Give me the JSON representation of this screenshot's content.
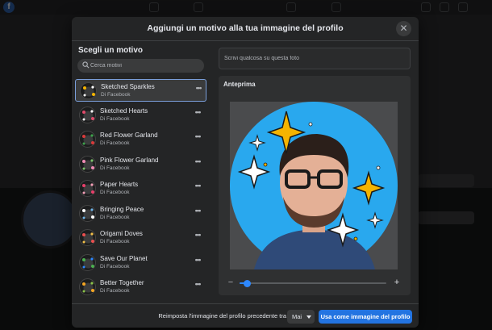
{
  "modal": {
    "title": "Aggiungi un motivo alla tua immagine del profilo",
    "close_icon": "close-icon"
  },
  "left": {
    "heading": "Scegli un motivo",
    "search_placeholder": "Cerca motivi",
    "items": [
      {
        "name": "Sketched Sparkles",
        "by": "Di Facebook",
        "selected": true
      },
      {
        "name": "Sketched Hearts",
        "by": "Di Facebook",
        "selected": false
      },
      {
        "name": "Red Flower Garland",
        "by": "Di Facebook",
        "selected": false
      },
      {
        "name": "Pink Flower Garland",
        "by": "Di Facebook",
        "selected": false
      },
      {
        "name": "Paper Hearts",
        "by": "Di Facebook",
        "selected": false
      },
      {
        "name": "Bringing Peace",
        "by": "Di Facebook",
        "selected": false
      },
      {
        "name": "Origami Doves",
        "by": "Di Facebook",
        "selected": false
      },
      {
        "name": "Save Our Planet",
        "by": "Di Facebook",
        "selected": false
      },
      {
        "name": "Better Together",
        "by": "Di Facebook",
        "selected": false
      }
    ]
  },
  "right": {
    "caption_placeholder": "Scrivi qualcosa su questa foto",
    "preview_heading": "Anteprima",
    "zoom_level": 0.05
  },
  "footer": {
    "revert_label": "Reimposta l'immagine del profilo precedente tra",
    "duration_value": "Mai",
    "submit_label": "Usa come immagine del profilo"
  },
  "colors": {
    "accent": "#2374e1",
    "preview_background": "#29a8ee",
    "sparkle_gold": "#f5b400"
  }
}
